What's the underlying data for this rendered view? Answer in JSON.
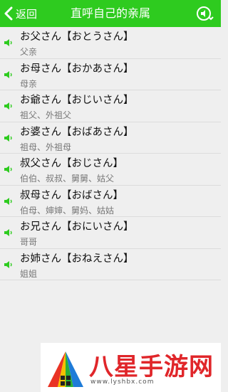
{
  "header": {
    "back_label": "返回",
    "title": "直呼自己的亲属"
  },
  "items": [
    {
      "jp": "お父さん【おとうさん】",
      "cn": "父亲"
    },
    {
      "jp": "お母さん【おかあさん】",
      "cn": "母亲"
    },
    {
      "jp": "お爺さん【おじいさん】",
      "cn": "祖父、外祖父"
    },
    {
      "jp": "お婆さん【おばあさん】",
      "cn": "祖母、外祖母"
    },
    {
      "jp": "叔父さん【おじさん】",
      "cn": "伯伯、叔叔、舅舅、姑父"
    },
    {
      "jp": "叔母さん【おばさん】",
      "cn": "伯母、婶婶、舅妈、姑姑"
    },
    {
      "jp": "お兄さん【おにいさん】",
      "cn": "哥哥"
    },
    {
      "jp": "お姉さん【おねえさん】",
      "cn": "姐姐"
    }
  ],
  "watermark": {
    "text": "八星手游网",
    "url": "www.lyshbx.com"
  },
  "colors": {
    "header_bg": "#2ecb1f",
    "speaker_icon": "#2ecb1f",
    "watermark_text": "#e0262a"
  }
}
